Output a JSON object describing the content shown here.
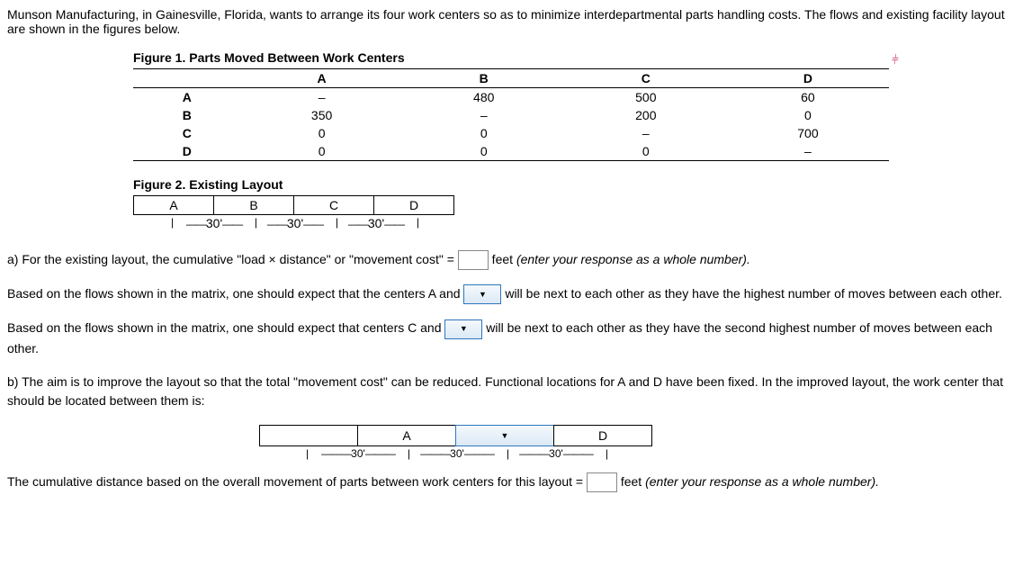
{
  "intro": "Munson Manufacturing, in Gainesville, Florida, wants to arrange its four work centers so as to minimize interdepartmental parts handling costs. The flows and existing facility layout are shown in the figures below.",
  "figure1": {
    "title": "Figure 1. Parts Moved Between Work Centers",
    "icon_name": "pageup-icon",
    "cols": [
      "A",
      "B",
      "C",
      "D"
    ],
    "rows": [
      {
        "label": "A",
        "cells": [
          "–",
          "480",
          "500",
          "60"
        ]
      },
      {
        "label": "B",
        "cells": [
          "350",
          "–",
          "200",
          "0"
        ]
      },
      {
        "label": "C",
        "cells": [
          "0",
          "0",
          "–",
          "700"
        ]
      },
      {
        "label": "D",
        "cells": [
          "0",
          "0",
          "0",
          "–"
        ]
      }
    ]
  },
  "figure2": {
    "title": "Figure 2. Existing Layout",
    "cells": [
      "A",
      "B",
      "C",
      "D"
    ],
    "dims": [
      "30'",
      "30'",
      "30'"
    ]
  },
  "qa": {
    "text1a": "a) For the existing layout, the cumulative \"load × distance\" or \"movement cost\" = ",
    "text1b": " feet ",
    "text1c": "(enter your response as a whole number).",
    "text2a": "Based on the flows shown in the matrix, one should expect that the centers A and ",
    "text2b": " will be next to each other as they have the highest number of moves between each other.",
    "text3a": "Based on the flows shown in the matrix, one should expect that centers C and ",
    "text3b": " will be next to each other as they have the second highest number of moves between each other."
  },
  "qb": {
    "intro": "b) The aim is to improve the layout so that the total \"movement cost\" can be reduced.  Functional locations for A and D have been fixed.  In the improved layout, the work center that should be located between them is:",
    "layout": {
      "cell1": "",
      "cell2": "A",
      "cell4": "D"
    },
    "dims": [
      "30'",
      "30'",
      "30'"
    ],
    "final_a": "The cumulative distance based on the overall movement of parts between work centers for this layout = ",
    "final_b": " feet ",
    "final_c": "(enter your response as a whole number)."
  },
  "chart_data": {
    "type": "table",
    "title": "Parts Moved Between Work Centers",
    "row_headers": [
      "A",
      "B",
      "C",
      "D"
    ],
    "col_headers": [
      "A",
      "B",
      "C",
      "D"
    ],
    "values": [
      [
        null,
        480,
        500,
        60
      ],
      [
        350,
        null,
        200,
        0
      ],
      [
        0,
        0,
        null,
        700
      ],
      [
        0,
        0,
        0,
        null
      ]
    ],
    "layout_existing": [
      "A",
      "B",
      "C",
      "D"
    ],
    "segment_length_ft": 30
  }
}
